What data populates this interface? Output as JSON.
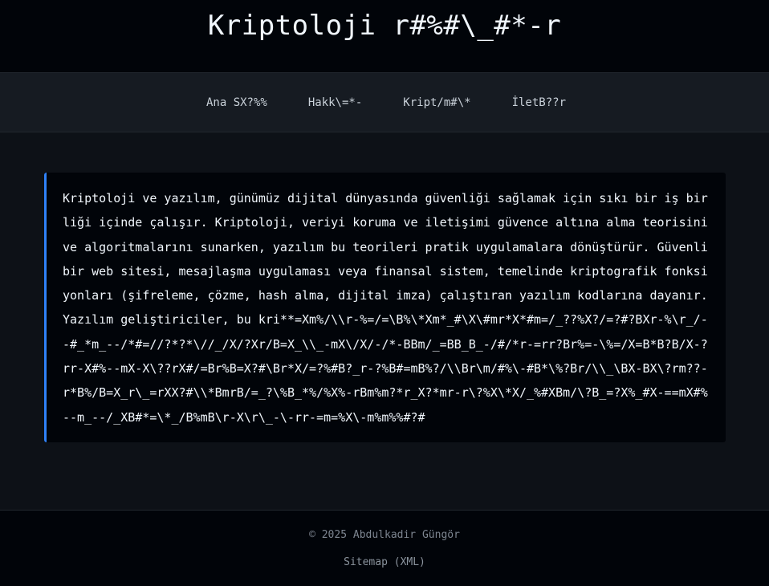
{
  "header": {
    "title": "Kriptoloji r#%#\\_#*-r"
  },
  "nav": {
    "items": [
      {
        "label": "Ana SX?%%"
      },
      {
        "label": "Hakk\\=*-"
      },
      {
        "label": "Kript/m#\\*"
      },
      {
        "label": "İletB??r"
      }
    ]
  },
  "main": {
    "article_text": "Kriptoloji ve yazılım, günümüz dijital dünyasında güvenliği sağlamak için sıkı bir iş birliği içinde çalışır. Kriptoloji, veriyi koruma ve iletişimi güvence altına alma teorisini ve algoritmalarını sunarken, yazılım bu teorileri pratik uygulamalara dönüştürür. Güvenli bir web sitesi, mesajlaşma uygulaması veya finansal sistem, temelinde kriptografik fonksiyonları (şifreleme, çözme, hash alma, dijital imza) çalıştıran yazılım kodlarına dayanır. Yazılım geliştiriciler, bu kri**=Xm%/\\\\r-%=/=\\B%\\*Xm*_#\\X\\#mr*X*#m=/_??%X?/=?#?BXr-%\\r_/--#_*m_--/*#=//?*?*\\//_/X/?Xr/B=X_\\\\_-mX\\/X/-/*-BBm/_=BB_B_-/#/*r-=rr?Br%=-\\%=/X=B*B?B/X-?rr-X#%--mX-X\\??rX#/=Br%B=X?#\\Br*X/=?%#B?_r-?%B#=mB%?/\\\\Br\\m/#%\\-#B*\\%?Br/\\\\_\\BX-BX\\?rm??-r*B%/B=X_r\\_=rXX?#\\\\*BmrB/=_?\\%B_*%/%X%-rBm%m?*r_X?*mr-r\\?%X\\*X/_%#XBm/\\?B_=?X%_#X-==mX#%--m_--/_XB#*=\\*_/B%mB\\r-X\\r\\_-\\-rr-=m=%X\\-m%m%%#?#"
  },
  "footer": {
    "copyright": "© 2025 Abdulkadir Güngör",
    "sitemap_label": "Sitemap (XML)"
  },
  "colors": {
    "page_background": "#0d1117",
    "header_background": "#010409",
    "nav_background": "#161b22",
    "article_background": "#010409",
    "accent_border": "#2f81f7",
    "text_primary": "#f0f6fc",
    "text_muted": "#7d8590"
  }
}
